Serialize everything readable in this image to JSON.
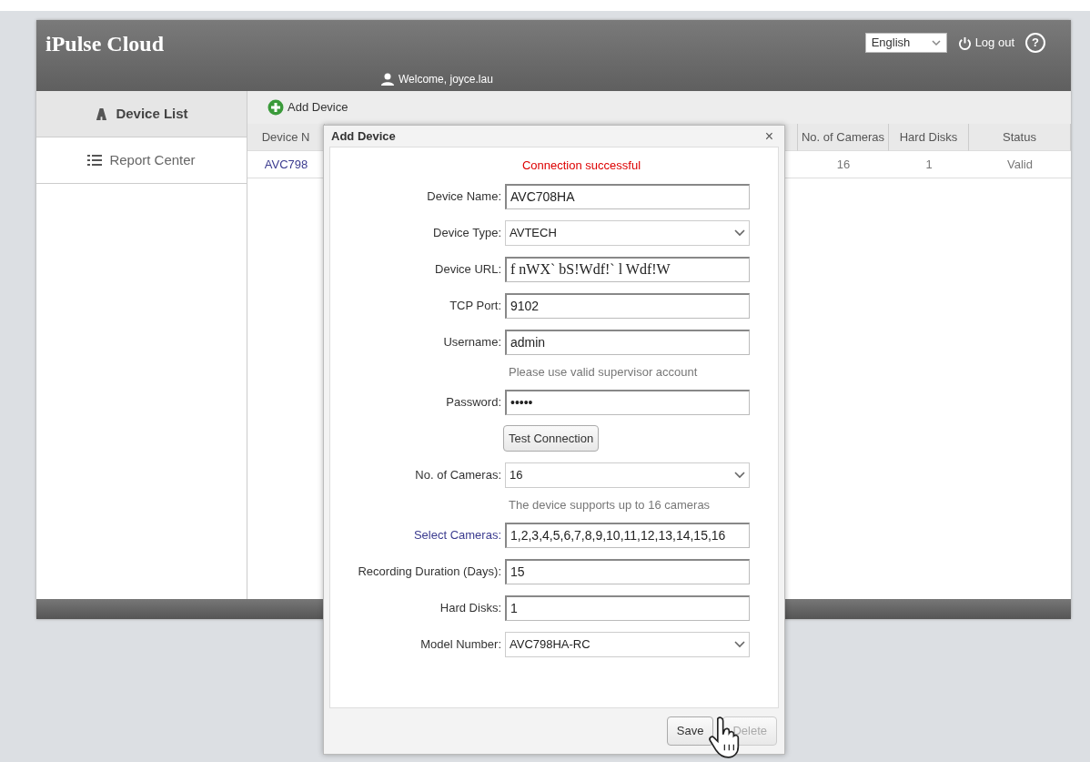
{
  "header": {
    "brand": "iPulse Cloud",
    "welcome": "Welcome, joyce.lau",
    "language": "English",
    "logout": "Log out",
    "help": "?"
  },
  "sidebar": {
    "items": [
      {
        "label": "Device List",
        "selected": true
      },
      {
        "label": "Report Center",
        "selected": false
      }
    ]
  },
  "toolbar": {
    "add_button": "Add Device"
  },
  "table": {
    "columns": [
      "Device N",
      "No. of Cameras",
      "Hard Disks",
      "Status"
    ],
    "rows": [
      {
        "cells": [
          "AVC798",
          "16",
          "1",
          "Valid"
        ]
      }
    ]
  },
  "dialog": {
    "title": "Add Device",
    "close": "×",
    "message": "Connection successful",
    "rows": [
      {
        "kind": "input",
        "label": "Device Name:",
        "value": "AVC708HA",
        "label_link": false
      },
      {
        "kind": "select",
        "label": "Device Type:",
        "value": "AVTECH",
        "label_link": false
      },
      {
        "kind": "garbled",
        "label": "Device URL:",
        "value": "f nWX` bS!Wdf!` l Wdf!W",
        "label_link": false
      },
      {
        "kind": "input",
        "label": "TCP Port:",
        "value": "9102",
        "label_link": false
      },
      {
        "kind": "input",
        "label": "Username:",
        "value": "admin",
        "label_link": false
      },
      {
        "kind": "hint",
        "text": "Please use valid supervisor account"
      },
      {
        "kind": "input",
        "label": "Password:",
        "value": "•••••",
        "label_link": false
      },
      {
        "kind": "button",
        "text": "Test Connection"
      },
      {
        "kind": "select",
        "label": "No. of Cameras:",
        "value": "16",
        "label_link": false
      },
      {
        "kind": "hint",
        "text": "The device supports up to 16 cameras"
      },
      {
        "kind": "input",
        "label": "Select Cameras:",
        "value": "1,2,3,4,5,6,7,8,9,10,11,12,13,14,15,16",
        "label_link": true
      },
      {
        "kind": "input",
        "label": "Recording Duration (Days):",
        "value": "15",
        "label_link": false
      },
      {
        "kind": "input",
        "label": "Hard Disks:",
        "value": "1",
        "label_link": false
      },
      {
        "kind": "select",
        "label": "Model Number:",
        "value": "AVC798HA-RC",
        "label_link": false
      }
    ],
    "buttons": [
      {
        "label": "Save",
        "disabled": false
      },
      {
        "label": "Delete",
        "disabled": true
      }
    ]
  }
}
